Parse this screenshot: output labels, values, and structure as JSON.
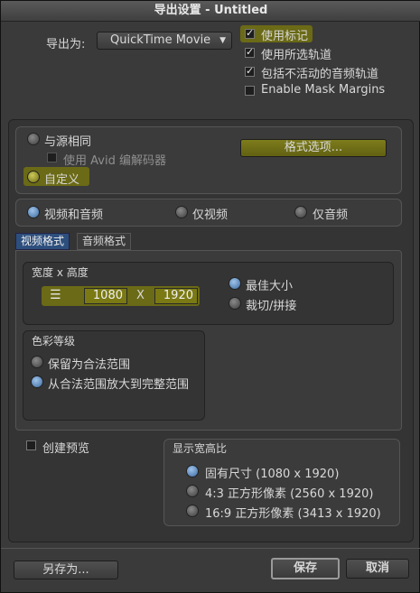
{
  "window": {
    "title": "导出设置 - Untitled"
  },
  "export_as": {
    "label": "导出为:",
    "value": "QuickTime Movie"
  },
  "options": {
    "use_markers": "使用标记",
    "use_selected_tracks": "使用所选轨道",
    "include_inactive_audio": "包括不活动的音频轨道",
    "enable_mask_margins": "Enable Mask Margins"
  },
  "source": {
    "same_as_source": "与源相同",
    "use_avid_codec": "使用 Avid 编解码器",
    "custom": "自定义",
    "format_options_button": "格式选项..."
  },
  "content": {
    "video_and_audio": "视频和音频",
    "video_only": "仅视频",
    "audio_only": "仅音频"
  },
  "tabs": {
    "video_format": "视频格式",
    "audio_format": "音频格式"
  },
  "size": {
    "label": "宽度 x 高度",
    "width": "1080",
    "separator": "X",
    "height": "1920",
    "best_size": "最佳大小",
    "crop_pad": "裁切/拼接"
  },
  "color": {
    "label": "色彩等级",
    "keep_legal": "保留为合法范围",
    "scale_to_full": "从合法范围放大到完整范围"
  },
  "preview": {
    "create_preview": "创建预览"
  },
  "aspect": {
    "label": "显示宽高比",
    "native": "固有尺寸 (1080 x 1920)",
    "four_three": "4:3 正方形像素 (2560 x 1920)",
    "sixteen_nine": "16:9 正方形像素 (3413 x 1920)"
  },
  "buttons": {
    "save_as": "另存为...",
    "save": "保存",
    "cancel": "取消"
  }
}
